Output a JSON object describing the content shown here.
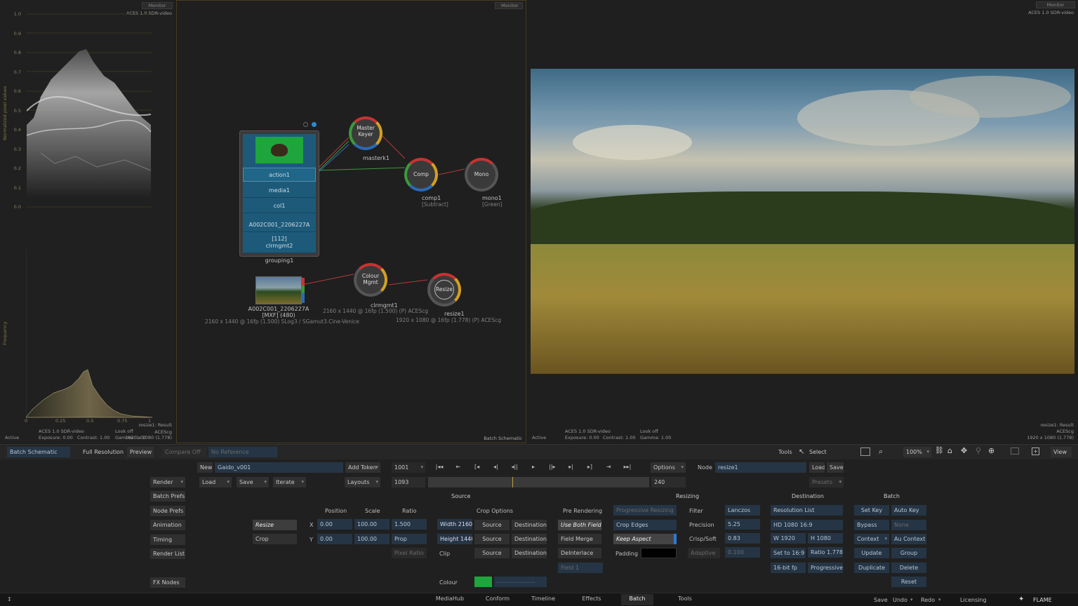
{
  "scopes": {
    "monitor_label": "Monitor",
    "colorspace": "ACES 1.0 SDR-video",
    "waveform": {
      "ylabel": "Normalized pixel values",
      "ticks": [
        "1.0",
        "0.9",
        "0.8",
        "0.7",
        "0.6",
        "0.5",
        "0.4",
        "0.3",
        "0.2",
        "0.1",
        "0.0"
      ]
    },
    "histogram": {
      "ylabel": "Frequency",
      "ticks": [
        "0",
        "0.25",
        "0.5",
        "0.75",
        "1"
      ]
    },
    "footer": {
      "result": "resize1: Result",
      "acescg": "ACEScg",
      "resolution": "1920 x 1080 (1.778)",
      "colorspace": "ACES 1.0 SDR-video",
      "look": "Look off",
      "exposure": "Exposure: 0.00",
      "contrast": "Contrast: 1.00",
      "gamma": "Gamma: 1.00",
      "status": "Active"
    }
  },
  "schematic": {
    "monitor_label": "Monitor",
    "title": "Batch Schematic",
    "group": {
      "items": [
        "action1",
        "media1",
        "col1",
        "A002C001_2206227A [112]",
        "clrmgmt2"
      ],
      "name": "grouping1"
    },
    "nodes": {
      "master": {
        "title": "Master Keyer",
        "name": "masterk1"
      },
      "comp": {
        "title": "Comp",
        "name": "comp1",
        "sub": "[Subtract]"
      },
      "mono": {
        "title": "Mono",
        "name": "mono1",
        "sub": "[Green]"
      },
      "colour": {
        "title": "Colour Mgmt",
        "name": "clrmgmt1",
        "info": "2160 x 1440 @ 16fp (1.500) (P) ACEScg"
      },
      "resize": {
        "title": "Resize",
        "name": "resize1",
        "info": "1920 x 1080 @ 16fp (1.778) (P) ACEScg"
      },
      "clip": {
        "name": "A002C001_2206227A",
        "sub": "[MXF] (480)",
        "info": "2160 x 1440 @ 16fp (1.500) SLog3 / SGamut3.Cine-Venice"
      }
    }
  },
  "viewer": {
    "monitor_label": "Monitor",
    "colorspace": "ACES 1.0 SDR-video",
    "footer": {
      "status": "Active",
      "colorspace": "ACES 1.0 SDR-video",
      "look": "Look off",
      "exposure": "Exposure: 0.00",
      "contrast": "Contrast: 1.00",
      "gamma": "Gamma: 1.00",
      "result": "resize1: Result",
      "acescg": "ACEScg",
      "resolution": "1920 x 1080 (1.778)"
    }
  },
  "viewbar": {
    "batch_schematic": "Batch Schematic",
    "full_resolution": "Full Resolution",
    "preview": "Preview",
    "compare": "Compare Off",
    "reference": "No Reference",
    "tools": "Tools",
    "select": "Select",
    "zoom": "100%",
    "view": "View"
  },
  "controls": {
    "new": "New",
    "batch_name": "Gaido_v001",
    "add_token": "Add Token",
    "frame": "1001",
    "frame_range_start": "1093",
    "frame_range_end": "240",
    "options": "Options",
    "node_label": "Node",
    "node_name": "resize1",
    "load": "Load",
    "save": "Save",
    "presets": "Presets",
    "render": "Render",
    "load2": "Load",
    "save2": "Save",
    "iterate": "Iterate",
    "layouts": "Layouts",
    "left": [
      "Batch Prefs",
      "Node Prefs",
      "Animation",
      "Timing",
      "Render List"
    ],
    "fx_nodes": "FX Nodes"
  },
  "resize_editor": {
    "source_hdr": "Source",
    "resizing_hdr": "Resizing",
    "destination_hdr": "Destination",
    "batch_hdr": "Batch",
    "mode_resize": "Resize",
    "mode_crop": "Crop",
    "position_hdr": "Position",
    "scale_hdr": "Scale",
    "ratio_hdr": "Ratio",
    "crop_options_hdr": "Crop Options",
    "pre_rendering_hdr": "Pre Rendering",
    "x": "X",
    "y": "Y",
    "pos_x": "0.00",
    "pos_y": "0.00",
    "scale_x": "100.00",
    "scale_y": "100.00",
    "ratio": "1.500",
    "prop": "Prop",
    "pixel_ratio": "Pixel Ratio",
    "width": "Width 2160",
    "height": "Height 1440",
    "clip": "Clip",
    "source": "Source",
    "destination": "Destination",
    "use_both_fields": "Use Both Fields",
    "field_merge": "Field Merge",
    "deinterlace": "DeInterlace",
    "field1": "Field 1",
    "progressive_resizing": "Progressive Resizing",
    "crop_edges": "Crop Edges",
    "keep_aspect": "Keep Aspect",
    "padding": "Padding",
    "filter": "Filter",
    "filter_val": "Lanczos",
    "precision": "Precision",
    "precision_val": "5.25",
    "crisp": "Crisp/Soft",
    "crisp_val": "0.83",
    "adaptive": "Adaptive",
    "adaptive_val": "0.100",
    "resolution_list": "Resolution List",
    "hd": "HD 1080 16:9",
    "w": "W 1920",
    "h": "H 1080",
    "set169": "Set to 16:9",
    "ratio1778": "Ratio 1.778",
    "bitfp": "16-bit fp",
    "progressive": "Progressive",
    "colour": "Colour",
    "colour_value": "#1fa53d",
    "set_key": "Set Key",
    "auto_key": "Auto Key",
    "bypass": "Bypass",
    "none": "None",
    "context": "Context",
    "au_context": "Au Context",
    "update": "Update",
    "group": "Group",
    "duplicate": "Duplicate",
    "delete": "Delete",
    "reset": "Reset"
  },
  "tabs": [
    "MediaHub",
    "Conform",
    "Timeline",
    "Effects",
    "Batch",
    "Tools"
  ],
  "statusbar": {
    "save": "Save",
    "undo": "Undo",
    "redo": "Redo",
    "licensing": "Licensing",
    "brand": "FLAME"
  }
}
